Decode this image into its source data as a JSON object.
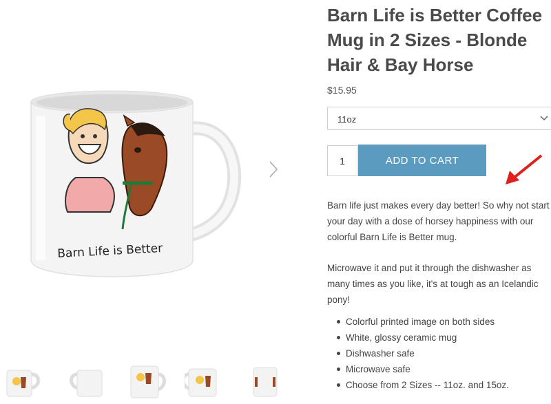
{
  "product": {
    "title": "Barn Life is Better Coffee Mug in 2 Sizes - Blonde Hair & Bay Horse",
    "price": "$15.95",
    "mug_text": "Barn Life is Better"
  },
  "size_select": {
    "selected": "11oz",
    "icon": "chevron-down-icon"
  },
  "cart": {
    "quantity": "1",
    "add_label": "ADD TO CART"
  },
  "gallery": {
    "next_icon": "chevron-right-icon",
    "thumb_count": 5
  },
  "description": {
    "para1": "Barn life just makes every day better! So why not start your day with a dose of horsey happiness with our colorful Barn Life is Better mug.",
    "para2": "Microwave it and put it through the dishwasher as many times as you like, it's at tough as an Icelandic pony!",
    "features": [
      "Colorful printed image on both sides",
      "White, glossy ceramic mug",
      "Dishwasher safe",
      "Microwave safe",
      "Choose from  2 Sizes -- 11oz. and 15oz."
    ]
  },
  "annotation": {
    "arrow_color": "#e0201c",
    "icon": "red-pointer-arrow-icon"
  },
  "colors": {
    "button": "#5b9bc0",
    "title": "#4a4a4a"
  }
}
